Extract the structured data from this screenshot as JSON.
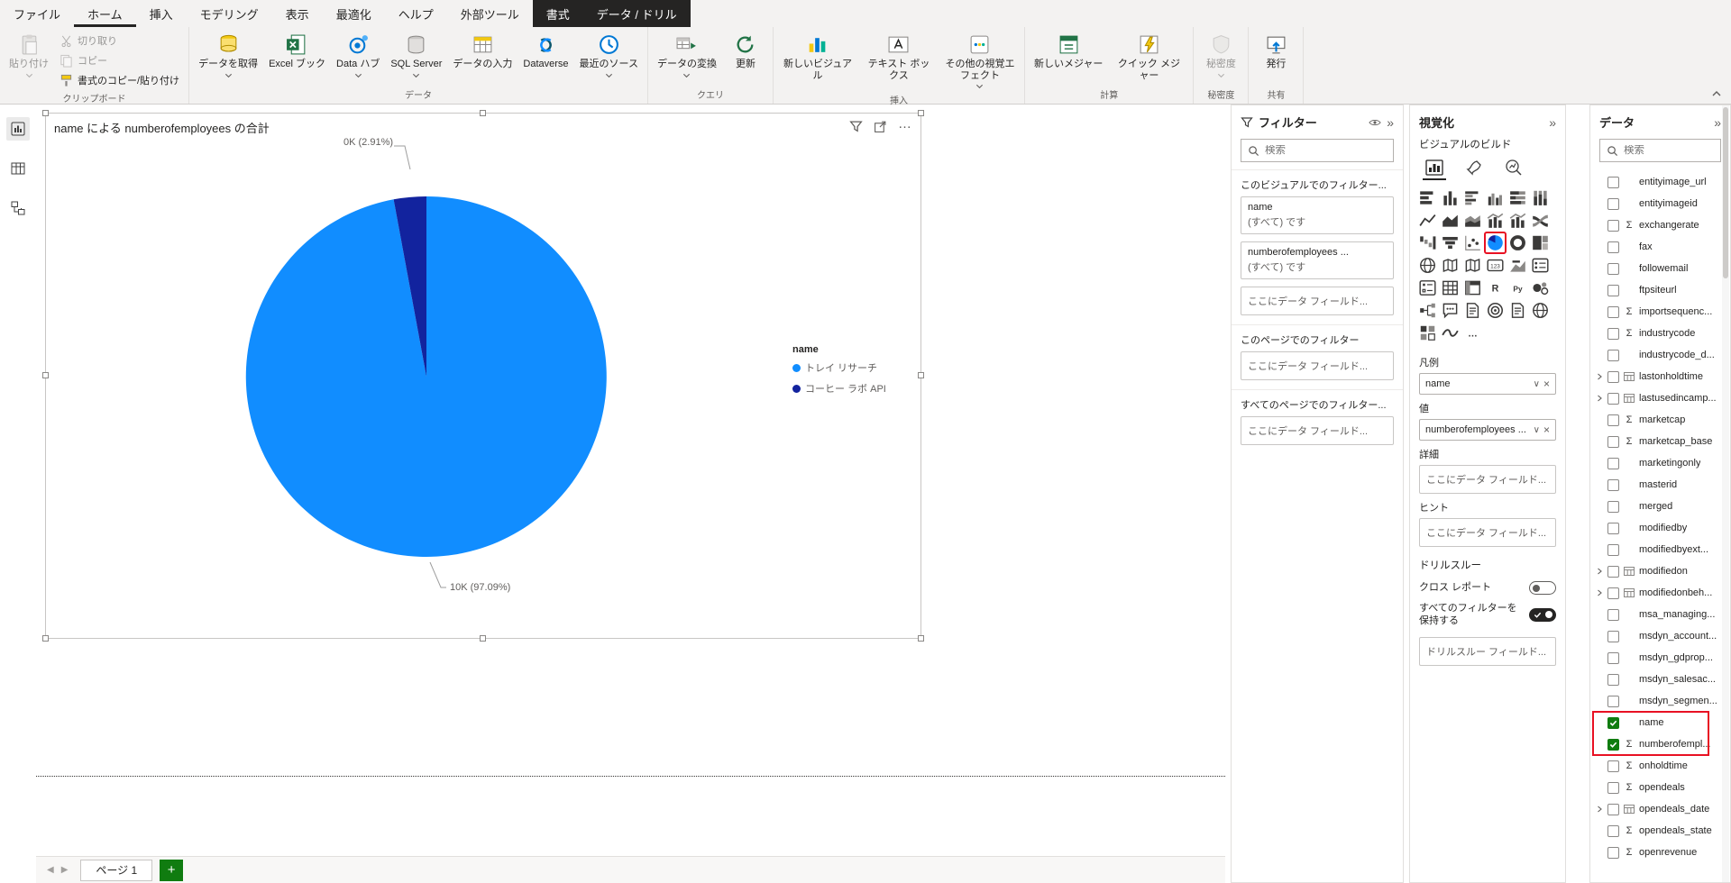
{
  "icons": {
    "sigma": "Σ",
    "more": "…",
    "collapse": "»",
    "caret": "∨",
    "close": "×",
    "back": "◀",
    "fwd": "▶",
    "plus": "+"
  },
  "ribbon": {
    "tabs": [
      {
        "label": "ファイル"
      },
      {
        "label": "ホーム",
        "active": true
      },
      {
        "label": "挿入"
      },
      {
        "label": "モデリング"
      },
      {
        "label": "表示"
      },
      {
        "label": "最適化"
      },
      {
        "label": "ヘルプ"
      },
      {
        "label": "外部ツール"
      },
      {
        "label": "書式",
        "dark": true
      },
      {
        "label": "データ / ドリル",
        "dark": true
      }
    ],
    "groups": [
      {
        "label": "クリップボード",
        "layout": "clipboard",
        "buttons": [
          {
            "label": "貼り付け",
            "icon": "paste",
            "disabled": true,
            "chevron": true
          },
          {
            "label": "切り取り",
            "icon": "cut",
            "disabled": true,
            "small": true
          },
          {
            "label": "コピー",
            "icon": "copy",
            "disabled": true,
            "small": true
          },
          {
            "label": "書式のコピー/貼り付け",
            "icon": "format",
            "small": true
          }
        ]
      },
      {
        "label": "データ",
        "buttons": [
          {
            "label": "データを取得",
            "icon": "getdata",
            "chevron": true
          },
          {
            "label": "Excel ブック",
            "icon": "excel"
          },
          {
            "label": "Data ハブ",
            "icon": "datahub",
            "chevron": true
          },
          {
            "label": "SQL Server",
            "icon": "sql",
            "chevron": true
          },
          {
            "label": "データの入力",
            "icon": "enterdata"
          },
          {
            "label": "Dataverse",
            "icon": "dataverse"
          },
          {
            "label": "最近のソース",
            "icon": "recent",
            "chevron": true
          }
        ]
      },
      {
        "label": "クエリ",
        "buttons": [
          {
            "label": "データの変換",
            "icon": "transform",
            "chevron": true
          },
          {
            "label": "更新",
            "icon": "refresh"
          }
        ]
      },
      {
        "label": "挿入",
        "buttons": [
          {
            "label": "新しいビジュアル",
            "icon": "newvisual"
          },
          {
            "label": "テキスト ボックス",
            "icon": "textbox"
          },
          {
            "label": "その他の視覚エフェクト",
            "icon": "morevisuals",
            "chevron": true
          }
        ]
      },
      {
        "label": "計算",
        "buttons": [
          {
            "label": "新しいメジャー",
            "icon": "newmeasure"
          },
          {
            "label": "クイック メジャー",
            "icon": "quickmeasure"
          }
        ]
      },
      {
        "label": "秘密度",
        "buttons": [
          {
            "label": "秘密度",
            "icon": "sensitivity",
            "disabled": true,
            "chevron": true
          }
        ]
      },
      {
        "label": "共有",
        "buttons": [
          {
            "label": "発行",
            "icon": "publish"
          }
        ]
      }
    ]
  },
  "canvas": {
    "page_label": "ページ 1"
  },
  "chart_data": {
    "type": "pie",
    "title": "name による numberofemployees の合計",
    "legend_title": "name",
    "categories": [
      "トレイ リサーチ",
      "コーヒー ラボ API"
    ],
    "values": [
      10000,
      300
    ],
    "percents": [
      97.09,
      2.91
    ],
    "data_labels": [
      "10K (97.09%)",
      "0K (2.91%)"
    ],
    "colors": [
      "#118DFF",
      "#12239E"
    ],
    "legend_position": "right"
  },
  "filters": {
    "title": "フィルター",
    "search_placeholder": "検索",
    "visual_section_label": "このビジュアルでのフィルター...",
    "page_section_label": "このページでのフィルター",
    "all_pages_section_label": "すべてのページでのフィルター...",
    "drop_placeholder": "ここにデータ フィールド...",
    "cards": [
      {
        "field": "name",
        "state": "(すべて) です"
      },
      {
        "field": "numberofemployees ...",
        "state": "(すべて) です"
      }
    ]
  },
  "visualizations": {
    "title": "視覚化",
    "build_label": "ビジュアルのビルド",
    "wells": {
      "legend_label": "凡例",
      "legend_value": "name",
      "values_label": "値",
      "values_value": "numberofemployees ...",
      "details_label": "詳細",
      "tooltips_label": "ヒント",
      "drop_placeholder": "ここにデータ フィールド..."
    },
    "drillthrough_label": "ドリルスルー",
    "cross_report_label": "クロス レポート",
    "keep_filters_label": "すべてのフィルターを保持する",
    "drill_drop_placeholder": "ドリルスルー フィールド...",
    "icon_grid": [
      {
        "name": "stacked-bar-chart",
        "glyph": "hbar"
      },
      {
        "name": "stacked-column-chart",
        "glyph": "vbar"
      },
      {
        "name": "clustered-bar-chart",
        "glyph": "hbar2"
      },
      {
        "name": "clustered-column-chart",
        "glyph": "vbar2"
      },
      {
        "name": "100-stacked-bar-chart",
        "glyph": "hbar100"
      },
      {
        "name": "100-stacked-column-chart",
        "glyph": "vbar100"
      },
      {
        "name": "line-chart",
        "glyph": "line"
      },
      {
        "name": "area-chart",
        "glyph": "area"
      },
      {
        "name": "stacked-area-chart",
        "glyph": "area2"
      },
      {
        "name": "line-stacked-column-chart",
        "glyph": "combo"
      },
      {
        "name": "line-clustered-column-chart",
        "glyph": "combo"
      },
      {
        "name": "ribbon-chart",
        "glyph": "ribbonc"
      },
      {
        "name": "waterfall-chart",
        "glyph": "waterfall"
      },
      {
        "name": "funnel-chart",
        "glyph": "funnel"
      },
      {
        "name": "scatter-chart",
        "glyph": "scatter"
      },
      {
        "name": "pie-chart",
        "glyph": "pie",
        "selected": true
      },
      {
        "name": "donut-chart",
        "glyph": "donut"
      },
      {
        "name": "treemap",
        "glyph": "treemap"
      },
      {
        "name": "map",
        "glyph": "globe"
      },
      {
        "name": "filled-map",
        "glyph": "fmap"
      },
      {
        "name": "shape-map",
        "glyph": "fmap"
      },
      {
        "name": "card",
        "glyph": "cardtext",
        "text": "123"
      },
      {
        "name": "kpi",
        "glyph": "kpi"
      },
      {
        "name": "multi-row-card",
        "glyph": "mcard"
      },
      {
        "name": "slicer",
        "glyph": "slicer"
      },
      {
        "name": "table",
        "glyph": "tableg"
      },
      {
        "name": "matrix",
        "glyph": "matrix"
      },
      {
        "name": "r-script-visual",
        "glyph": "text",
        "text": "R"
      },
      {
        "name": "python-visual",
        "glyph": "text",
        "text": "Py"
      },
      {
        "name": "key-influencers",
        "glyph": "keyinf"
      },
      {
        "name": "decomposition-tree",
        "glyph": "tree"
      },
      {
        "name": "qa-visual",
        "glyph": "qa"
      },
      {
        "name": "smart-narrative",
        "glyph": "doc"
      },
      {
        "name": "metrics",
        "glyph": "goal"
      },
      {
        "name": "paginated-report",
        "glyph": "doc"
      },
      {
        "name": "arcgis-map",
        "glyph": "globe"
      },
      {
        "name": "power-apps",
        "glyph": "appsq"
      },
      {
        "name": "power-automate",
        "glyph": "wave"
      },
      {
        "name": "more-visuals",
        "glyph": "text",
        "text": "…"
      }
    ]
  },
  "data_pane": {
    "title": "データ",
    "search_placeholder": "検索",
    "fields": [
      {
        "name": "entityimage_url"
      },
      {
        "name": "entityimageid"
      },
      {
        "name": "exchangerate",
        "sigma": true
      },
      {
        "name": "fax"
      },
      {
        "name": "followemail"
      },
      {
        "name": "ftpsiteurl"
      },
      {
        "name": "importsequenc...",
        "sigma": true
      },
      {
        "name": "industrycode",
        "sigma": true
      },
      {
        "name": "industrycode_d..."
      },
      {
        "name": "lastonholdtime",
        "expand": true,
        "table": true
      },
      {
        "name": "lastusedincamp...",
        "expand": true,
        "table": true
      },
      {
        "name": "marketcap",
        "sigma": true
      },
      {
        "name": "marketcap_base",
        "sigma": true
      },
      {
        "name": "marketingonly"
      },
      {
        "name": "masterid"
      },
      {
        "name": "merged"
      },
      {
        "name": "modifiedby"
      },
      {
        "name": "modifiedbyext..."
      },
      {
        "name": "modifiedon",
        "expand": true,
        "table": true
      },
      {
        "name": "modifiedonbeh...",
        "expand": true,
        "table": true
      },
      {
        "name": "msa_managing..."
      },
      {
        "name": "msdyn_account..."
      },
      {
        "name": "msdyn_gdprop..."
      },
      {
        "name": "msdyn_salesac..."
      },
      {
        "name": "msdyn_segmen..."
      },
      {
        "name": "name",
        "checked": true,
        "boxed": true
      },
      {
        "name": "numberofempl...",
        "checked": true,
        "sigma": true,
        "boxed": true
      },
      {
        "name": "onholdtime",
        "sigma": true
      },
      {
        "name": "opendeals",
        "sigma": true
      },
      {
        "name": "opendeals_date",
        "expand": true,
        "table": true
      },
      {
        "name": "opendeals_state",
        "sigma": true
      },
      {
        "name": "openrevenue",
        "sigma": true
      }
    ]
  }
}
